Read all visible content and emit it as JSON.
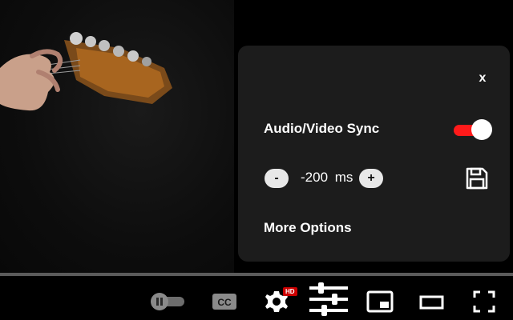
{
  "panel": {
    "close_label": "x",
    "av_sync_label": "Audio/Video Sync",
    "av_sync_enabled": true,
    "decrement_label": "-",
    "increment_label": "+",
    "delay_value": "-200",
    "delay_unit": "ms",
    "more_options_label": "More Options",
    "accent_color": "#ff1a1a"
  },
  "controls": {
    "hd_badge": "HD",
    "icons": [
      "autoplay-toggle-icon",
      "captions-icon",
      "settings-icon",
      "sliders-icon",
      "miniplayer-icon",
      "theater-mode-icon",
      "fullscreen-icon"
    ]
  }
}
